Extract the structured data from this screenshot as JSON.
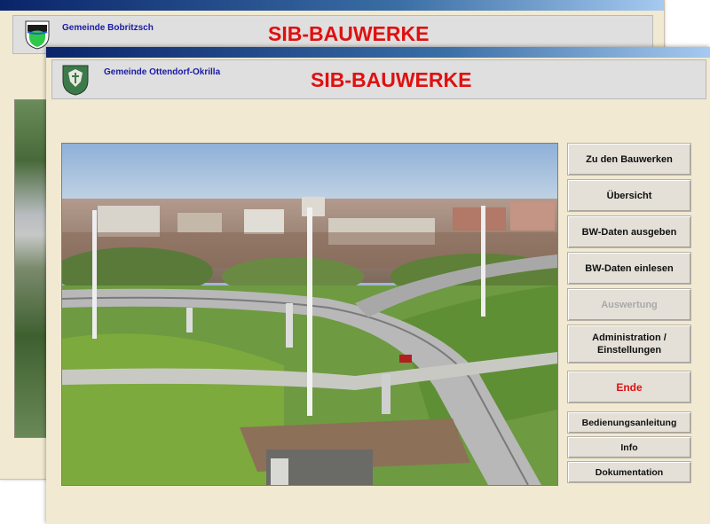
{
  "back_window": {
    "gemeinde": "Gemeinde Bobritzsch",
    "title": "SIB-BAUWERKE"
  },
  "front_window": {
    "gemeinde": "Gemeinde Ottendorf-Okrilla",
    "title": "SIB-BAUWERKE"
  },
  "menu": {
    "zu_den_bauwerken": "Zu den Bauwerken",
    "uebersicht": "Übersicht",
    "bw_daten_ausgeben": "BW-Daten ausgeben",
    "bw_daten_einlesen": "BW-Daten einlesen",
    "auswertung": "Auswertung",
    "administration": "Administration /",
    "einstellungen": "Einstellungen",
    "ende": "Ende",
    "bedienungsanleitung": "Bedienungsanleitung",
    "info": "Info",
    "dokumentation": "Dokumentation"
  },
  "icons": {
    "back_crest": "municipal-crest-icon",
    "front_crest": "municipal-crest-icon"
  },
  "colors": {
    "title_red": "#e01010",
    "gemeinde_blue": "#1a1aa6",
    "window_bg": "#f1e9d1"
  }
}
